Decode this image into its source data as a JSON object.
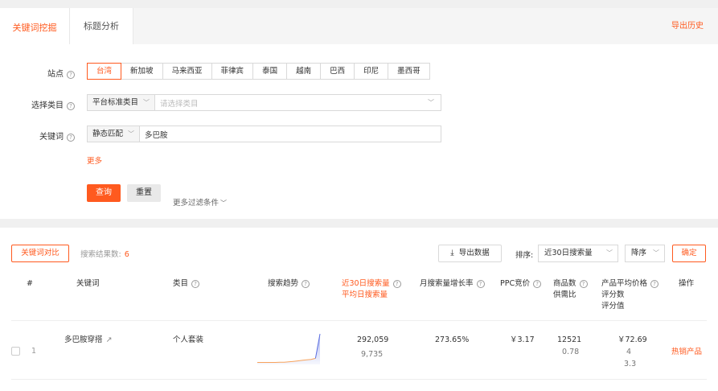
{
  "tabs": [
    {
      "label": "关键词挖掘"
    },
    {
      "label": "标题分析"
    }
  ],
  "export_history": "导出历史",
  "form": {
    "site_label": "站点",
    "sites": [
      "台湾",
      "新加坡",
      "马来西亚",
      "菲律宾",
      "泰国",
      "越南",
      "巴西",
      "印尼",
      "墨西哥"
    ],
    "category_label": "选择类目",
    "category_prefix": "平台标准类目",
    "category_placeholder": "请选择类目",
    "keyword_label": "关键词",
    "keyword_prefix": "静态匹配",
    "keyword_value": "多巴胺",
    "more": "更多",
    "query_btn": "查询",
    "reset_btn": "重置",
    "more_filters": "更多过滤条件"
  },
  "toolbar": {
    "compare_btn": "关键词对比",
    "result_label": "搜索结果数:",
    "result_count": "6",
    "export_btn": "导出数据",
    "sort_label": "排序:",
    "sort_field": "近30日搜索量",
    "sort_order": "降序",
    "confirm_btn": "确定"
  },
  "table": {
    "headers": {
      "index": "#",
      "keyword": "关键词",
      "category": "类目",
      "trend": "搜索趋势",
      "search_30d": "近30日搜索量",
      "search_daily": "平均日搜索量",
      "growth": "月搜索量增长率",
      "ppc": "PPC竞价",
      "product_count": "商品数",
      "supply_ratio": "供需比",
      "avg_price": "产品平均价格",
      "rating_count": "评分数",
      "rating": "评分值",
      "action": "操作"
    },
    "rows": [
      {
        "index": "1",
        "keyword": "多巴胺穿搭",
        "category": "个人套装",
        "search_30d": "292,059",
        "search_daily": "9,735",
        "growth": "273.65%",
        "ppc": "￥3.17",
        "product_count": "12521",
        "supply_ratio": "0.78",
        "avg_price": "￥72.69",
        "rating_count": "4",
        "rating": "3.3",
        "action": "热销产品",
        "trend": [
          2,
          2,
          2,
          2,
          2,
          2.2,
          2.1,
          2.5,
          3,
          3.5,
          4,
          4.5,
          5,
          6,
          30
        ]
      }
    ]
  },
  "colors": {
    "accent": "#ff5a1f",
    "trend_line": "#5b6ee1",
    "trend_fill_top": "#f7a35c"
  }
}
